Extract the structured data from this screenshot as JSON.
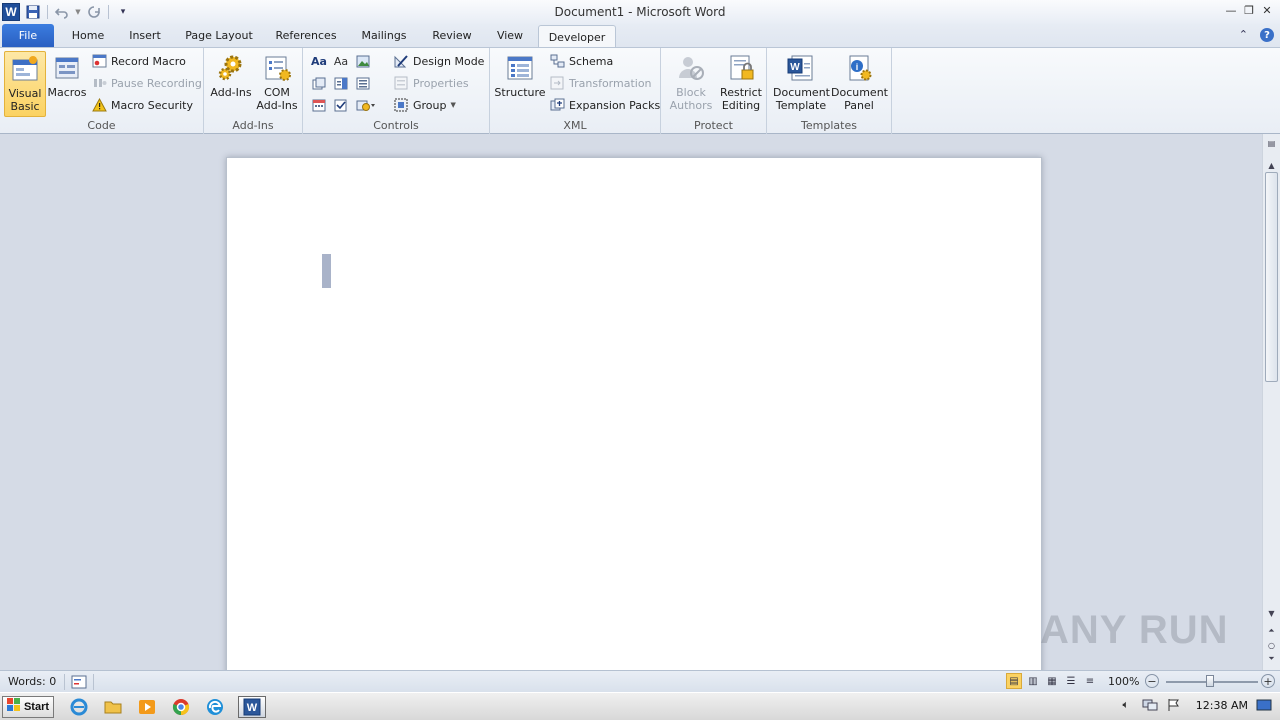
{
  "window": {
    "title": "Document1 - Microsoft Word",
    "minimize_glyph": "—",
    "restore_glyph": "❐",
    "close_glyph": "✕"
  },
  "qat": {
    "app_icon": "W",
    "save_icon": "save-icon",
    "undo_icon": "undo-icon",
    "redo_icon": "redo-icon",
    "customize_icon": "customize-icon"
  },
  "tabs": [
    {
      "label": "File"
    },
    {
      "label": "Home"
    },
    {
      "label": "Insert"
    },
    {
      "label": "Page Layout"
    },
    {
      "label": "References"
    },
    {
      "label": "Mailings"
    },
    {
      "label": "Review"
    },
    {
      "label": "View"
    },
    {
      "label": "Developer"
    }
  ],
  "ribbon": {
    "code": {
      "label": "Code",
      "visual_basic": "Visual Basic",
      "macros": "Macros",
      "record_macro": "Record Macro",
      "pause_recording": "Pause Recording",
      "macro_security": "Macro Security"
    },
    "addins": {
      "label": "Add-Ins",
      "add_ins": "Add-Ins",
      "com_add_ins": "COM Add-Ins"
    },
    "controls": {
      "label": "Controls",
      "design_mode": "Design Mode",
      "properties": "Properties",
      "group": "Group"
    },
    "xml": {
      "label": "XML",
      "structure": "Structure",
      "schema": "Schema",
      "transformation": "Transformation",
      "expansion_packs": "Expansion Packs"
    },
    "protect": {
      "label": "Protect",
      "block_authors": "Block Authors",
      "restrict_editing": "Restrict Editing"
    },
    "templates": {
      "label": "Templates",
      "document_template": "Document Template",
      "document_panel": "Document Panel"
    }
  },
  "status": {
    "words": "Words: 0",
    "zoom": "100%"
  },
  "taskbar": {
    "start": "Start",
    "clock": "12:38 AM"
  },
  "watermark": "ANY RUN",
  "colors": {
    "file_tab": "#2a5fc1",
    "selected_button": "#fbd262",
    "page": "#ffffff",
    "workspace": "#d5dbe6"
  }
}
